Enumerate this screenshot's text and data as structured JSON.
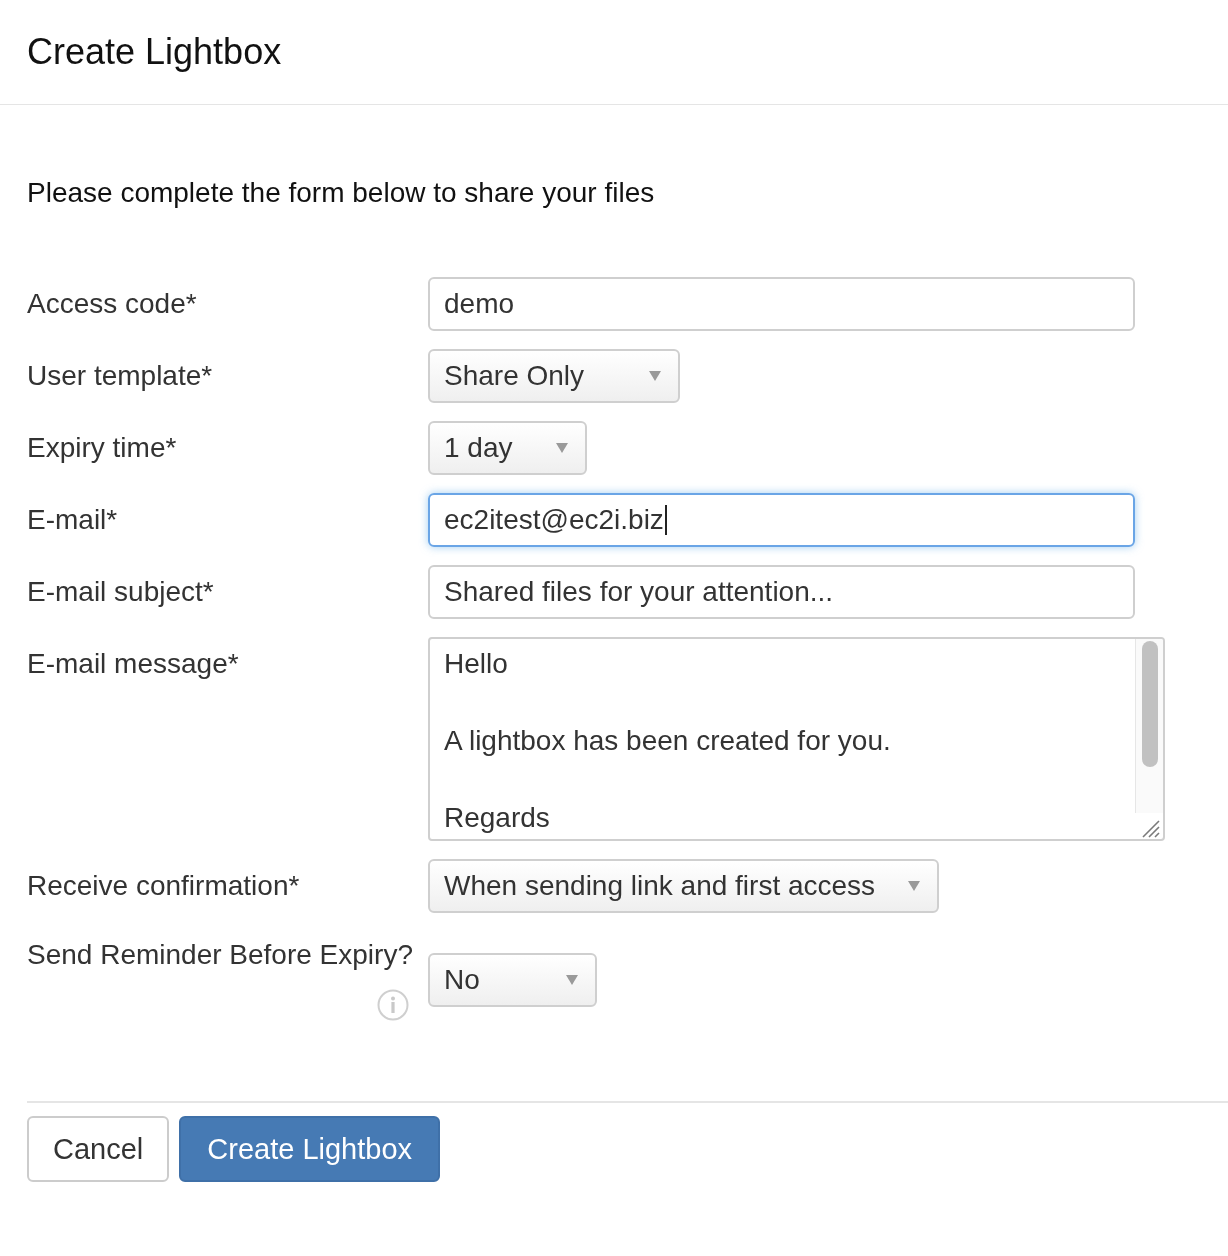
{
  "dialog": {
    "title": "Create Lightbox"
  },
  "intro": "Please complete the form below to share your files",
  "fields": [
    {
      "kind": "text",
      "label": "Access code*",
      "value": "demo",
      "focused": false,
      "info": false
    },
    {
      "kind": "select",
      "label": "User template*",
      "value": "Share Only",
      "focused": false,
      "info": false
    },
    {
      "kind": "select",
      "label": "Expiry time*",
      "value": "1 day",
      "focused": false,
      "info": false
    },
    {
      "kind": "text",
      "label": "E-mail*",
      "value": "ec2itest@ec2i.biz",
      "focused": true,
      "info": false
    },
    {
      "kind": "text",
      "label": "E-mail subject*",
      "value": "Shared files for your attention...",
      "focused": false,
      "info": false
    },
    {
      "kind": "textarea",
      "label": "E-mail message*",
      "value": "Hello\n\nA lightbox has been created for you.\n\nRegards",
      "focused": false,
      "info": false
    },
    {
      "kind": "select",
      "label": "Receive confirmation*",
      "value": "When sending link and first access",
      "focused": false,
      "info": false
    },
    {
      "kind": "select",
      "label": "Send Reminder Before Expiry?",
      "value": "No",
      "focused": false,
      "info": true
    }
  ],
  "buttons": [
    {
      "kind": "default",
      "label": "Cancel"
    },
    {
      "kind": "primary",
      "label": "Create Lightbox"
    }
  ]
}
